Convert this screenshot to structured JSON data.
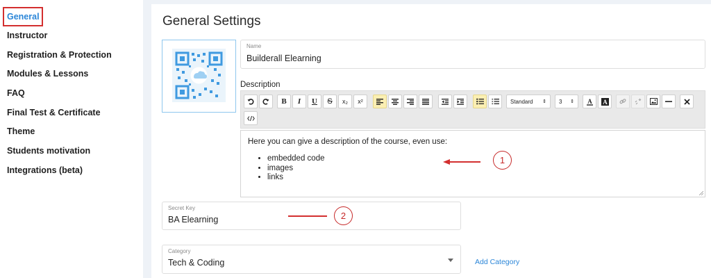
{
  "sidebar": {
    "items": [
      {
        "label": "General",
        "active": true
      },
      {
        "label": "Instructor"
      },
      {
        "label": "Registration & Protection"
      },
      {
        "label": "Modules & Lessons"
      },
      {
        "label": "FAQ"
      },
      {
        "label": "Final Test & Certificate"
      },
      {
        "label": "Theme"
      },
      {
        "label": "Students motivation"
      },
      {
        "label": "Integrations (beta)"
      }
    ]
  },
  "main": {
    "title": "General Settings",
    "name_field": {
      "label": "Name",
      "value": "Builderall Elearning"
    },
    "description": {
      "label": "Description",
      "toolbar": {
        "format_select": "Standard",
        "size_select": "3",
        "subscript": "x₂",
        "superscript": "x²"
      },
      "intro": "Here you can give a description of the course, even use:",
      "items": [
        "embedded code",
        "images",
        "links"
      ]
    },
    "secret_key": {
      "label": "Secret Key",
      "value": "BA Elearning"
    },
    "category": {
      "label": "Category",
      "value": "Tech & Coding"
    },
    "add_category": "Add Category"
  },
  "annotations": {
    "one": "1",
    "two": "2"
  },
  "colors": {
    "accent": "#2b86d8",
    "annotation": "#d32f2f",
    "highlight": "#fbefb3"
  }
}
